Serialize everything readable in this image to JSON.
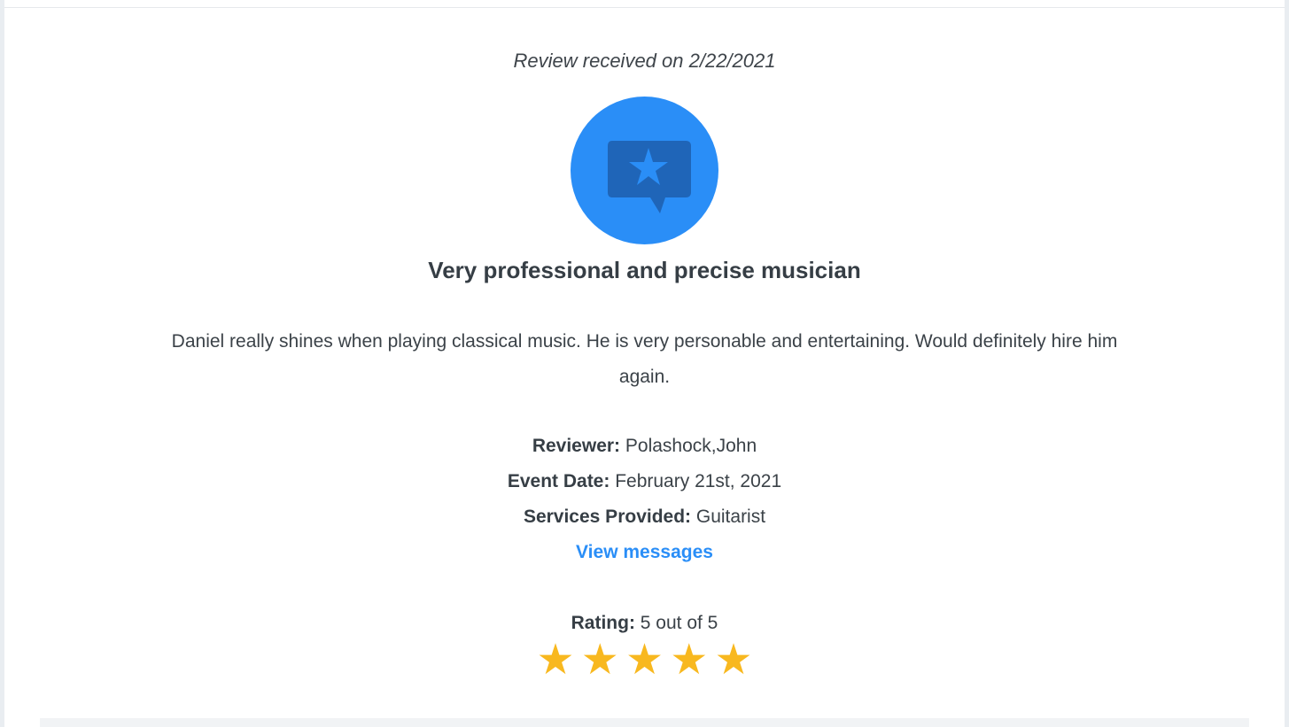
{
  "review": {
    "received_text": "Review received on 2/22/2021",
    "icon": "review-star-bubble-icon",
    "title": "Very professional and precise musician",
    "body": "Daniel really shines when playing classical music. He is very personable and entertaining. Would definitely hire him again.",
    "reviewer_label": "Reviewer:",
    "reviewer_value": "Polashock,John",
    "event_date_label": "Event Date:",
    "event_date_value": "February 21st, 2021",
    "services_label": "Services Provided:",
    "services_value": "Guitarist",
    "view_messages": "View messages",
    "rating_label": "Rating:",
    "rating_value": "5 out of 5",
    "rating_stars": 5,
    "star_glyph": "★"
  },
  "colors": {
    "accent": "#2a8ef7",
    "icon_dark": "#1f65b8",
    "star": "#f8b81f",
    "text": "#3b4248"
  }
}
